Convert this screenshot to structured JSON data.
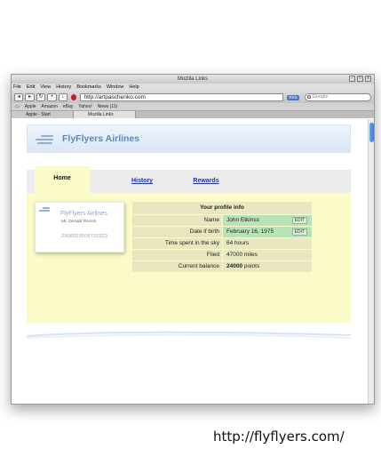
{
  "window": {
    "title": "Mozilla Links"
  },
  "menu": [
    "File",
    "Edit",
    "View",
    "History",
    "Bookmarks",
    "Window",
    "Help"
  ],
  "url": "http://artpaschenko.com",
  "search_placeholder": "Google",
  "bookmarks": [
    "Apple",
    "Amazon",
    "eBay",
    "Yahoo!",
    "News (11)"
  ],
  "tabs": [
    "Apple - Start",
    "Mozilla Links"
  ],
  "site": {
    "title": "FlyFlyers Airlines"
  },
  "nav": {
    "home": "Home",
    "history": "History",
    "rewards": "Rewards"
  },
  "card": {
    "title": "FlyFlyers Airlines",
    "holder": "Mr. Donald Rossin",
    "number": "2908023509732323"
  },
  "profile": {
    "header": "Your profile info",
    "name_label": "Name",
    "name": "John Etkinss",
    "edit": "EDIT",
    "dob_label": "Date if birth",
    "dob": "February 16, 1975",
    "sky_label": "Time spent in the sky",
    "sky": "64 hours",
    "flied_label": "Flied",
    "flied": "47000 miles",
    "balance_label": "Current balance",
    "balance_value": "24000",
    "balance_unit": "points"
  },
  "footer_url": "http://flyflyers.com/"
}
